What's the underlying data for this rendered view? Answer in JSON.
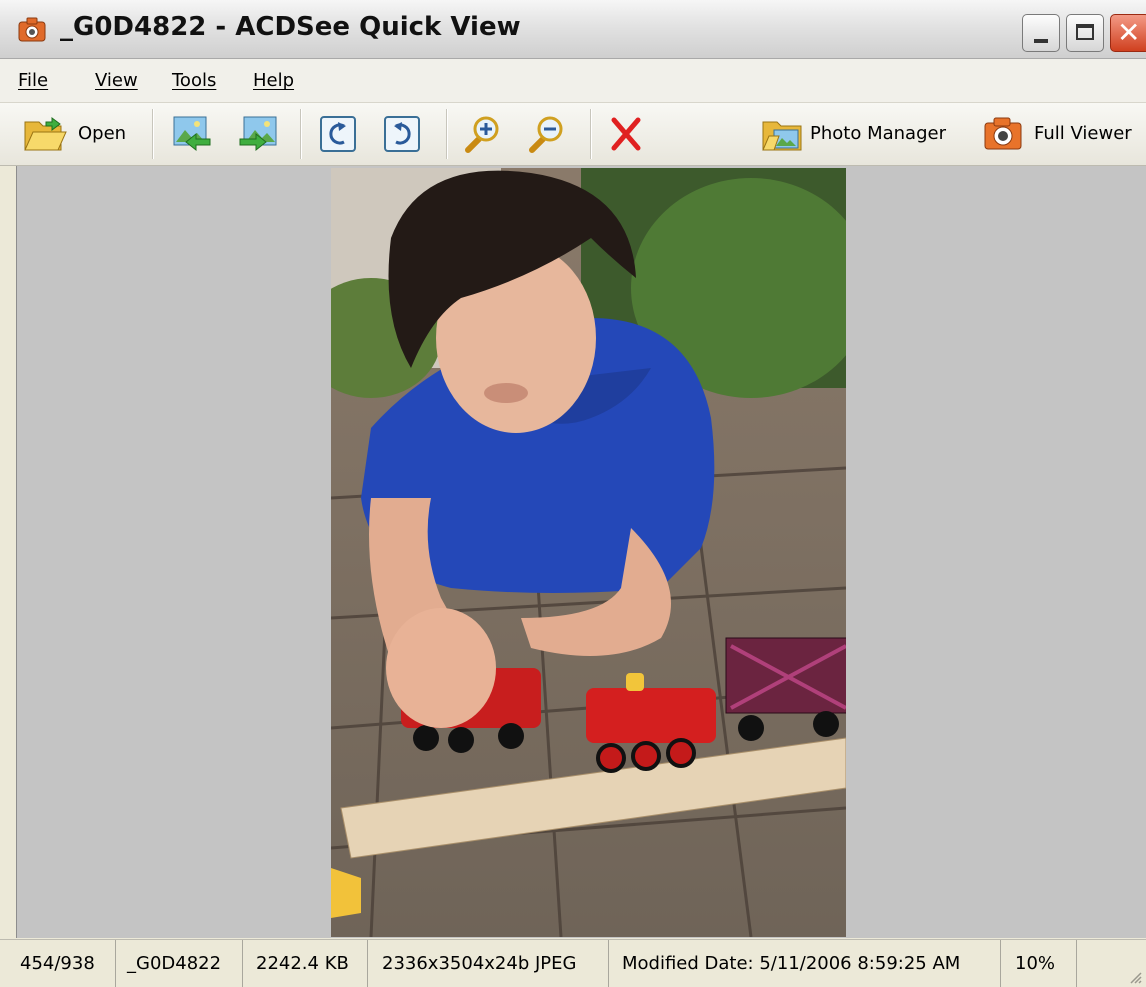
{
  "window": {
    "title": "_G0D4822 - ACDSee Quick View",
    "app_icon": "camera-icon",
    "controls": [
      "minimize-icon",
      "maximize-icon",
      "close-icon"
    ]
  },
  "menu": {
    "items": [
      {
        "label": "File"
      },
      {
        "label": "View"
      },
      {
        "label": "Tools"
      },
      {
        "label": "Help"
      }
    ]
  },
  "toolbar": {
    "open_label": "Open",
    "open_icon": "folder-open-icon",
    "previous_icon": "previous-image-icon",
    "next_icon": "next-image-icon",
    "rotate_left_icon": "rotate-left-icon",
    "rotate_right_icon": "rotate-right-icon",
    "zoom_in_icon": "zoom-in-icon",
    "zoom_out_icon": "zoom-out-icon",
    "delete_icon": "delete-x-icon",
    "photo_manager_label": "Photo Manager",
    "photo_manager_icon": "photo-manager-folder-icon",
    "full_viewer_label": "Full Viewer",
    "full_viewer_icon": "full-viewer-camera-icon"
  },
  "image": {
    "description_icon": "photo-boy-playing-with-toy-train"
  },
  "status": {
    "position": "454/938",
    "filename": "_G0D4822",
    "filesize": "2242.4 KB",
    "dimensions": "2336x3504x24b JPEG",
    "modified": "Modified Date: 5/11/2006 8:59:25 AM",
    "zoom": "10%"
  },
  "colors": {
    "viewer_background": "#c4c4c4",
    "close_button": "#d0401f",
    "delete_red": "#e02020"
  }
}
